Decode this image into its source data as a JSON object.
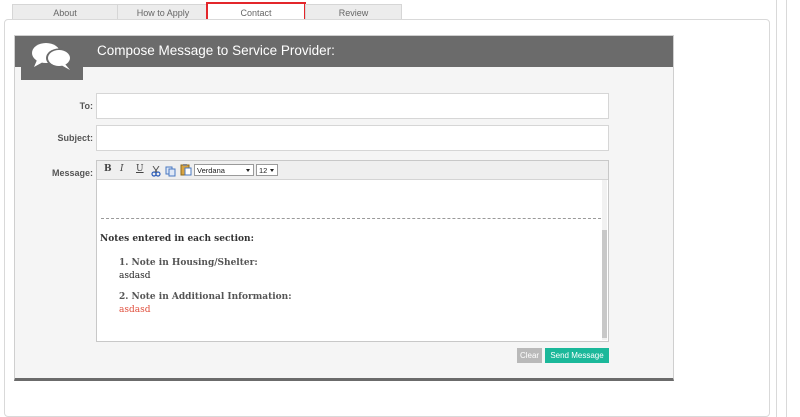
{
  "tabs": [
    {
      "label": "About"
    },
    {
      "label": "How to Apply"
    },
    {
      "label": "Contact",
      "active": true
    },
    {
      "label": "Review"
    }
  ],
  "compose": {
    "title": "Compose Message to Service Provider:",
    "icon": "chat-bubbles-icon"
  },
  "form": {
    "to_label": "To:",
    "to_value": "",
    "subject_label": "Subject:",
    "subject_value": "",
    "message_label": "Message:"
  },
  "editor": {
    "toolbar": {
      "bold": "B",
      "italic": "I",
      "underline": "U",
      "font": "Verdana",
      "size": "12"
    },
    "notes_heading": "Notes entered in each section:",
    "notes": [
      {
        "title": "1. Note in Housing/Shelter:",
        "value": "asdasd",
        "color": "#222222"
      },
      {
        "title": "2. Note in Additional Information:",
        "value": "asdasd",
        "color": "#e04e3c"
      }
    ]
  },
  "buttons": {
    "clear": "Clear",
    "send": "Send Message"
  },
  "colors": {
    "header": "#6b6b6b",
    "send_button": "#1bb89a",
    "clear_button": "#b9b9b9",
    "active_tab_border": "#e3262b"
  }
}
